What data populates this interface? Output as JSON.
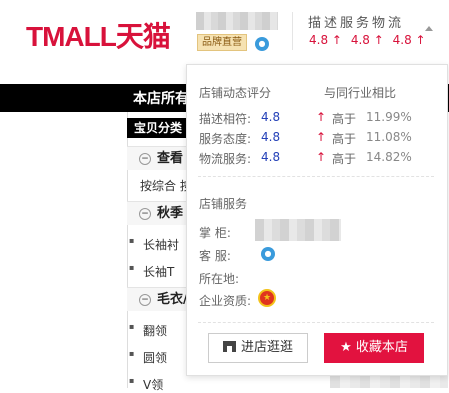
{
  "header": {
    "logo_text": "TMALL天猫",
    "brand_badge": "品牌直营",
    "score_title": "描述服务物流",
    "scores": [
      {
        "value": "4.8",
        "arrow": "↑"
      },
      {
        "value": "4.8",
        "arrow": "↑"
      },
      {
        "value": "4.8",
        "arrow": "↑"
      }
    ]
  },
  "background": {
    "bar_text": "本店所有",
    "category_header": "宝贝分类",
    "rows": [
      {
        "type": "group",
        "label": "查看"
      },
      {
        "type": "plain",
        "label": "按综合 按"
      },
      {
        "type": "group",
        "label": "秋季"
      },
      {
        "type": "sub",
        "label": "长袖衬"
      },
      {
        "type": "sub",
        "label": "长袖T"
      },
      {
        "type": "group",
        "label": "毛衣/"
      },
      {
        "type": "sub",
        "label": "翻领"
      },
      {
        "type": "sub",
        "label": "圆领"
      },
      {
        "type": "sub",
        "label": "V领"
      }
    ]
  },
  "popup": {
    "rating_title": "店铺动态评分",
    "compare_title": "与同行业相比",
    "ratings": [
      {
        "label": "描述相符:",
        "value": "4.8",
        "arrow": "↑",
        "cmp": "高于",
        "pct": "11.99%"
      },
      {
        "label": "服务态度:",
        "value": "4.8",
        "arrow": "↑",
        "cmp": "高于",
        "pct": "11.08%"
      },
      {
        "label": "物流服务:",
        "value": "4.8",
        "arrow": "↑",
        "cmp": "高于",
        "pct": "14.82%"
      }
    ],
    "service_title": "店铺服务",
    "services": {
      "keeper": "掌 柜:",
      "cs": "客 服:",
      "location": "所在地:",
      "license": "企业资质:"
    },
    "btn_visit": "进店逛逛",
    "btn_fav": "收藏本店",
    "colors": {
      "accent": "#d8123b",
      "value": "#2441b8",
      "fav_button": "#e2123f"
    }
  }
}
